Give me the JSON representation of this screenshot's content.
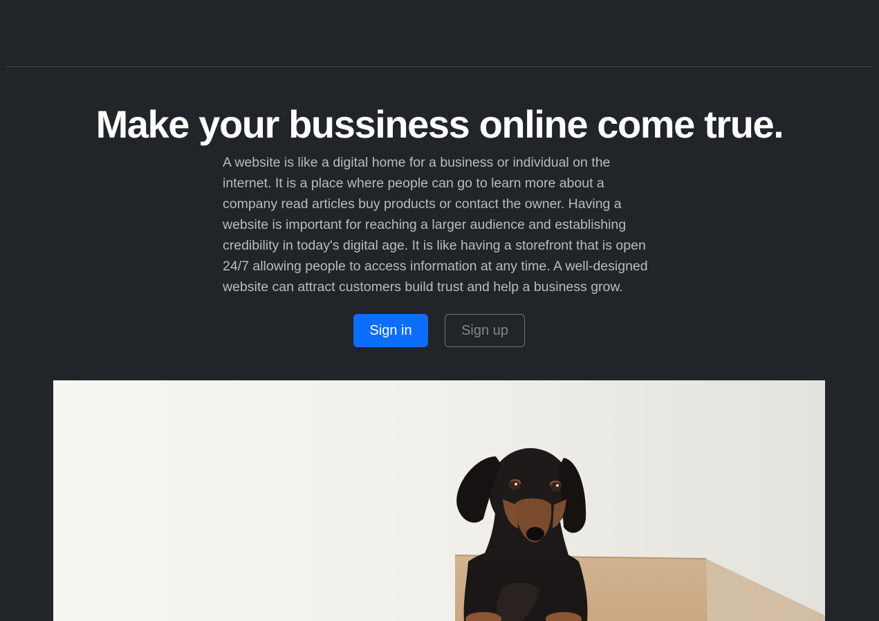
{
  "hero": {
    "title": "Make your bussiness online come true.",
    "description": "A website is like a digital home for a business or individual on the internet. It is a place where people can go to learn more about a company read articles buy products or contact the owner. Having a website is important for reaching a larger audience and establishing credibility in today's digital age. It is like having a storefront that is open 24/7 allowing people to access information at any time. A well-designed website can attract customers build trust and help a business grow.",
    "primary_button": "Sign in",
    "secondary_button": "Sign up"
  },
  "colors": {
    "background": "#212529",
    "primary": "#0d6efd",
    "outline": "#6c757d"
  }
}
